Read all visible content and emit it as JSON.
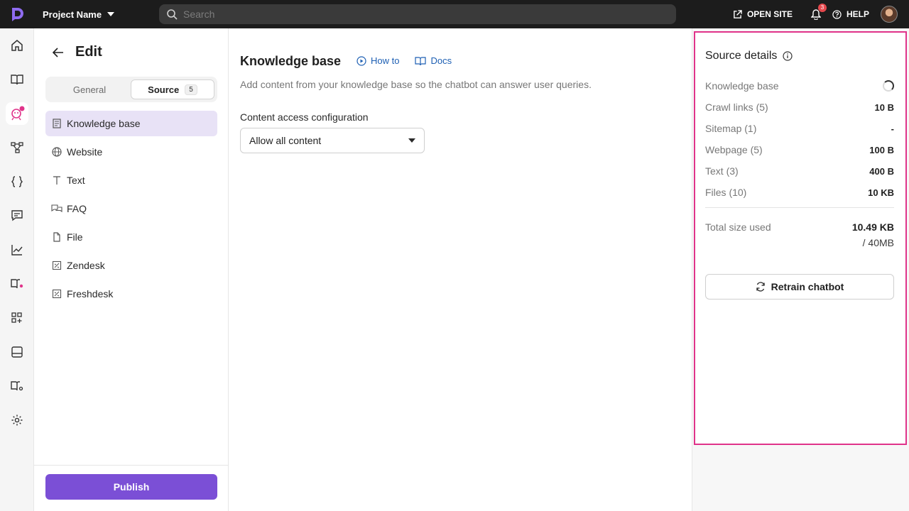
{
  "topbar": {
    "project_name": "Project Name",
    "search_placeholder": "Search",
    "open_site_label": "OPEN SITE",
    "notifications_count": "3",
    "help_label": "HELP"
  },
  "edit": {
    "title": "Edit",
    "tabs": [
      {
        "label": "General"
      },
      {
        "label": "Source",
        "count": "5"
      }
    ],
    "nav": [
      {
        "label": "Knowledge base",
        "icon": "book-page-icon"
      },
      {
        "label": "Website",
        "icon": "globe-icon"
      },
      {
        "label": "Text",
        "icon": "text-icon"
      },
      {
        "label": "FAQ",
        "icon": "chat-bubbles-icon"
      },
      {
        "label": "File",
        "icon": "file-icon"
      },
      {
        "label": "Zendesk",
        "icon": "zendesk-icon"
      },
      {
        "label": "Freshdesk",
        "icon": "freshdesk-icon"
      }
    ],
    "publish_label": "Publish"
  },
  "main": {
    "title": "Knowledge base",
    "how_to_label": "How to",
    "docs_label": "Docs",
    "description": "Add content from your knowledge base so the chatbot can answer user queries.",
    "content_access_label": "Content access configuration",
    "content_access_value": "Allow all content"
  },
  "details": {
    "title": "Source details",
    "rows": [
      {
        "label": "Knowledge base",
        "value": ""
      },
      {
        "label": "Crawl links (5)",
        "value": "10 B"
      },
      {
        "label": "Sitemap (1)",
        "value": "-"
      },
      {
        "label": "Webpage (5)",
        "value": "100 B"
      },
      {
        "label": "Text (3)",
        "value": "400 B"
      },
      {
        "label": "Files (10)",
        "value": "10 KB"
      }
    ],
    "total_label": "Total size used",
    "total_value": "10.49 KB",
    "total_limit": "/ 40MB",
    "retrain_label": "Retrain chatbot"
  },
  "colors": {
    "accent": "#7b4fd6",
    "highlight_border": "#e0338a",
    "active_nav_bg": "#e8e2f6",
    "link": "#1d5fb3"
  }
}
